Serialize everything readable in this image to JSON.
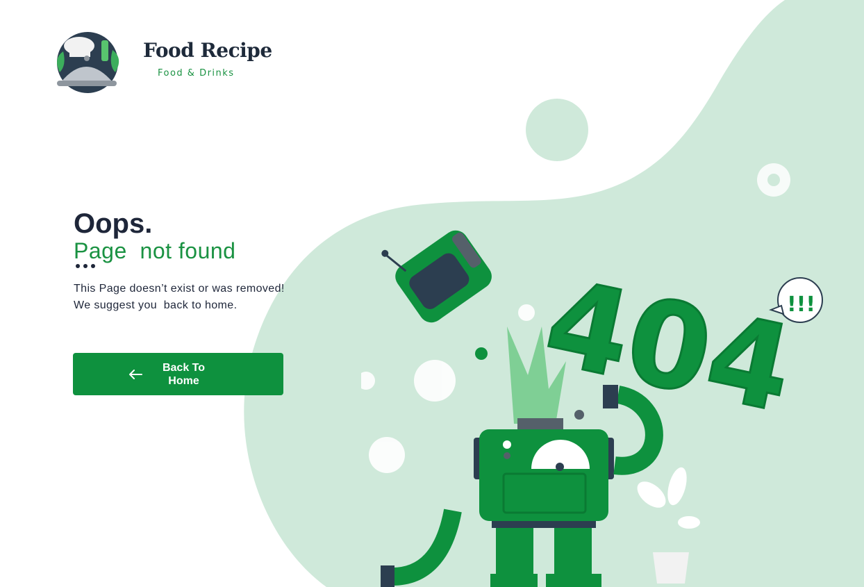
{
  "brand": {
    "name": "Food Recipe",
    "tagline": "Food & Drinks",
    "logo_icon": "chef-cloche-icon"
  },
  "error": {
    "heading": "Oops.",
    "subheading": "Page  not found",
    "message_line1": "This Page doesn’t exist or was removed!",
    "message_line2": "We suggest you  back to home."
  },
  "actions": {
    "back_label": "Back To Home",
    "back_icon": "arrow-left-icon"
  },
  "illustration": {
    "code": "404",
    "speech": "!!!",
    "name": "broken-robot-404-illustration"
  },
  "colors": {
    "accent": "#0e913e",
    "blob": "#cfe9da",
    "text": "#1e2639"
  }
}
